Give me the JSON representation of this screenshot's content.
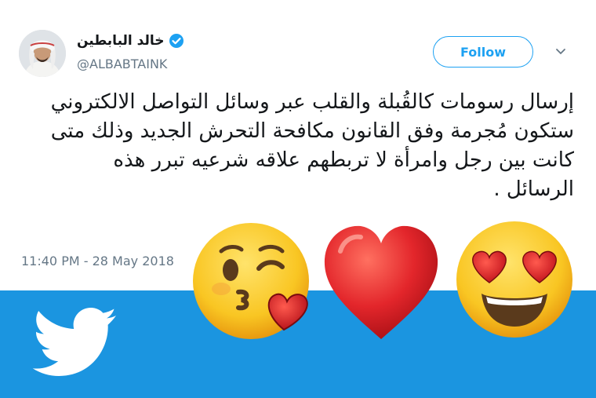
{
  "tweet": {
    "author": {
      "display_name": "خالد البابطين",
      "handle": "@ALBABTAINK",
      "verified": true
    },
    "follow_label": "Follow",
    "text_lines": [
      "إرسال رسومات كالقُبلة والقلب عبر وسائل التواصل الالكتروني",
      "ستكون مُجرمة وفق القانون مكافحة التحرش الجديد وذلك متى",
      "كانت بين رجل وامرأة لا تربطهم علاقه شرعيه تبرر هذه",
      "الرسائل ."
    ],
    "timestamp": "11:40 PM - 28 May 2018"
  },
  "banner": {
    "background_color": "#1b95e0",
    "logo_icon": "twitter-bird-icon",
    "emojis": [
      "kissing-face-with-heart-icon",
      "red-heart-icon",
      "heart-eyes-face-icon"
    ]
  },
  "colors": {
    "accent": "#1da1f2",
    "text": "#14171a",
    "secondary_text": "#657786"
  }
}
